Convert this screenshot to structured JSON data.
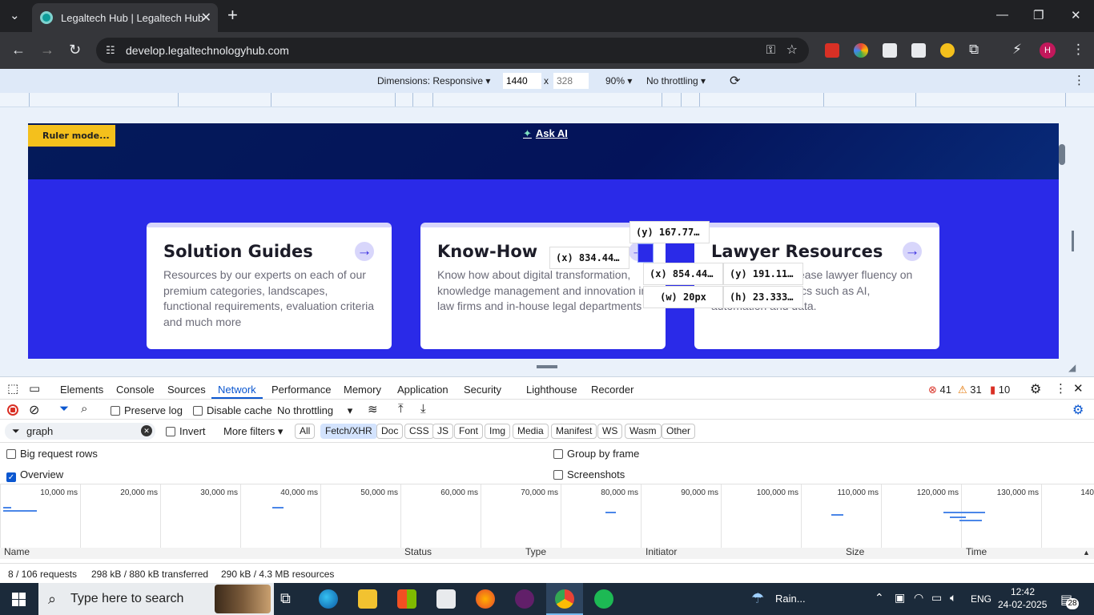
{
  "browser": {
    "tab_title": "Legaltech Hub | Legaltech Hub",
    "url": "develop.legaltechnologyhub.com",
    "new_tab_label": "+",
    "profile_initial": "H"
  },
  "device_toolbar": {
    "dimensions_label": "Dimensions: Responsive",
    "width": "1440",
    "height": "328",
    "x_sep": "x",
    "zoom": "90%",
    "throttle": "No throttling"
  },
  "page": {
    "ruler_mode_label": "Ruler mode...",
    "ask_ai_label": "Ask AI",
    "cards": [
      {
        "title": "Solution Guides",
        "text": "Resources by our experts on each of our premium categories, landscapes, functional requirements, evaluation criteria and much more"
      },
      {
        "title": "Know-How",
        "text": "Know how about digital transformation, knowledge management and innovation in law firms and in-house legal departments"
      },
      {
        "title": "Lawyer Resources",
        "text": "Resources to increase lawyer fluency on key legal tech topics such as AI, automation and data."
      }
    ],
    "ruler_tips": {
      "y1": "(y) 167.77…",
      "x1": "(x) 834.44…",
      "x2": "(x) 854.44…",
      "y2": "(y) 191.11…",
      "w": "(w) 20px",
      "h": "(h) 23.333…"
    }
  },
  "devtools": {
    "tabs": [
      "Elements",
      "Console",
      "Sources",
      "Network",
      "Performance",
      "Memory",
      "Application",
      "Security",
      "Lighthouse",
      "Recorder"
    ],
    "active_tab": "Network",
    "errors": "41",
    "warnings": "31",
    "issues": "10",
    "network_toolbar": {
      "preserve_log": "Preserve log",
      "disable_cache": "Disable cache",
      "throttle": "No throttling"
    },
    "filter": {
      "value": "graph",
      "invert": "Invert",
      "more_filters": "More filters",
      "chips": [
        "All",
        "Fetch/XHR",
        "Doc",
        "CSS",
        "JS",
        "Font",
        "Img",
        "Media",
        "Manifest",
        "WS",
        "Wasm",
        "Other"
      ],
      "active_chip": "Fetch/XHR"
    },
    "options": {
      "big_rows": "Big request rows",
      "overview": "Overview",
      "group_by_frame": "Group by frame",
      "screenshots": "Screenshots"
    },
    "timeline_ticks": [
      "10,000 ms",
      "20,000 ms",
      "30,000 ms",
      "40,000 ms",
      "50,000 ms",
      "60,000 ms",
      "70,000 ms",
      "80,000 ms",
      "90,000 ms",
      "100,000 ms",
      "110,000 ms",
      "120,000 ms",
      "130,000 ms",
      "140"
    ],
    "columns": [
      "Name",
      "Status",
      "Type",
      "Initiator",
      "Size",
      "Time"
    ],
    "status": {
      "requests": "8 / 106 requests",
      "transferred": "298 kB / 880 kB transferred",
      "resources": "290 kB / 4.3 MB resources"
    }
  },
  "taskbar": {
    "search_placeholder": "Type here to search",
    "weather": "Rain...",
    "lang": "ENG",
    "time": "12:42",
    "date": "24-02-2025",
    "notifications": "28"
  }
}
